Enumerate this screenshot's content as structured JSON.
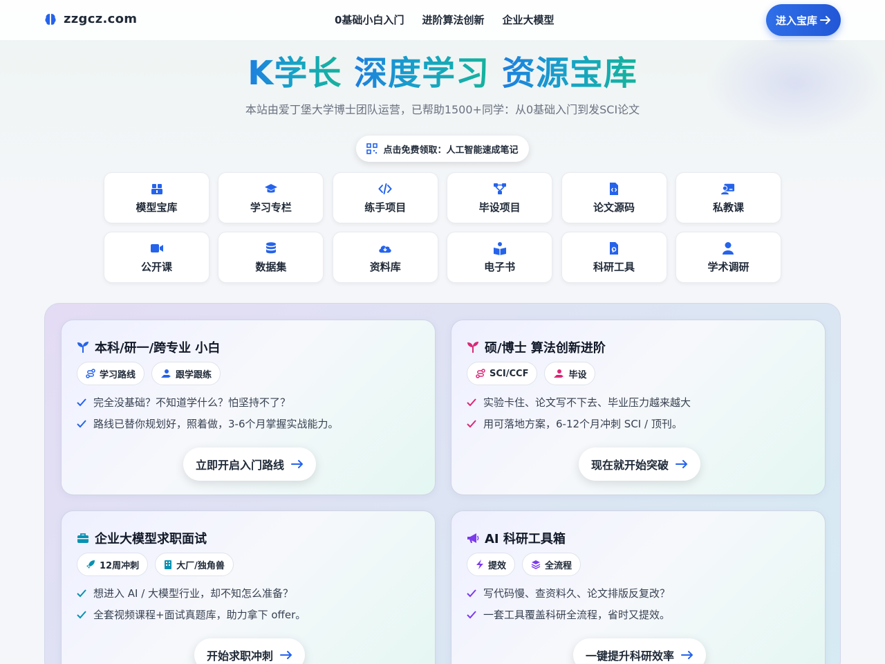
{
  "header": {
    "logo_text": "zzgcz.com",
    "nav": [
      "0基础小白入门",
      "进阶算法创新",
      "企业大模型"
    ],
    "enter_label": "进入宝库"
  },
  "hero": {
    "title_part1": "K学长",
    "title_part2": "深度学习",
    "title_part3": "资源宝库",
    "subtitle": "本站由爱丁堡大学博士团队运营，已帮助1500+同学：从0基础入门到发SCI论文",
    "free_label": "点击免费领取：人工智能速成笔记"
  },
  "resources": [
    {
      "label": "模型宝库",
      "icon": "boxes-icon"
    },
    {
      "label": "学习专栏",
      "icon": "graduation-cap-icon"
    },
    {
      "label": "练手项目",
      "icon": "code-icon"
    },
    {
      "label": "毕设项目",
      "icon": "diagram-icon"
    },
    {
      "label": "论文源码",
      "icon": "file-code-icon"
    },
    {
      "label": "私教课",
      "icon": "teacher-icon"
    },
    {
      "label": "公开课",
      "icon": "video-icon"
    },
    {
      "label": "数据集",
      "icon": "database-icon"
    },
    {
      "label": "资料库",
      "icon": "cloud-download-icon"
    },
    {
      "label": "电子书",
      "icon": "book-reader-icon"
    },
    {
      "label": "科研工具",
      "icon": "file-tool-icon"
    },
    {
      "label": "学术调研",
      "icon": "user-icon"
    }
  ],
  "cards": [
    {
      "title": "本科/研一/跨专业 小白",
      "icon_color": "#2563eb",
      "tags": [
        "学习路线",
        "跟学跟练"
      ],
      "bullets": [
        "完全没基础？不知道学什么？怕坚持不了？",
        "路线已替你规划好，照着做，3-6个月掌握实战能力。"
      ],
      "cta": "立即开启入门路线"
    },
    {
      "title": "硕/博士 算法创新进阶",
      "icon_color": "#db2777",
      "tags": [
        "SCI/CCF",
        "毕设"
      ],
      "bullets": [
        "实验卡住、论文写不下去、毕业压力越来越大",
        "用可落地方案，6-12个月冲刺 SCI / 顶刊。"
      ],
      "cta": "现在就开始突破"
    },
    {
      "title": "企业大模型求职面试",
      "icon_color": "#0891b2",
      "tags": [
        "12周冲刺",
        "大厂/独角兽"
      ],
      "bullets": [
        "想进入 AI / 大模型行业，却不知怎么准备？",
        "全套视频课程+面试真题库，助力拿下 offer。"
      ],
      "cta": "开始求职冲刺"
    },
    {
      "title": "AI 科研工具箱",
      "icon_color": "#7c3aed",
      "tags": [
        "提效",
        "全流程"
      ],
      "bullets": [
        "写代码慢、查资料久、论文排版反复改？",
        "一套工具覆盖科研全流程，省时又提效。"
      ],
      "cta": "一键提升科研效率"
    }
  ]
}
